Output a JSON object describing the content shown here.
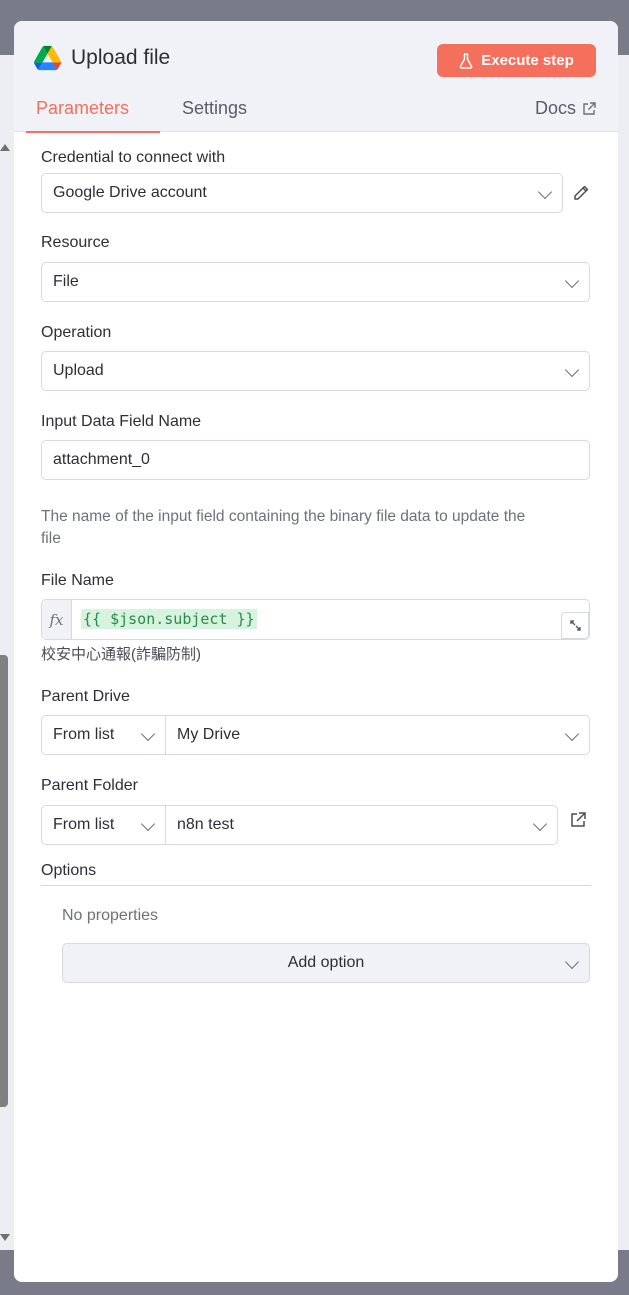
{
  "header": {
    "title": "Upload file",
    "execute_label": "Execute step",
    "tabs": [
      {
        "label": "Parameters",
        "active": true
      },
      {
        "label": "Settings",
        "active": false
      }
    ],
    "docs_label": "Docs"
  },
  "fields": {
    "credential": {
      "label": "Credential to connect with",
      "value": "Google Drive account"
    },
    "resource": {
      "label": "Resource",
      "value": "File"
    },
    "operation": {
      "label": "Operation",
      "value": "Upload"
    },
    "input_field": {
      "label": "Input Data Field Name",
      "value": "attachment_0",
      "hint_line1": "The name of the input field containing the binary file data to update the",
      "hint_line2": "file"
    },
    "file_name": {
      "label": "File Name",
      "fx": "fx",
      "expression": "{{ $json.subject }}",
      "preview": "校安中心通報(詐騙防制)"
    },
    "parent_drive": {
      "label": "Parent Drive",
      "mode": "From list",
      "value": "My Drive"
    },
    "parent_folder": {
      "label": "Parent Folder",
      "mode": "From list",
      "value": "n8n test"
    },
    "options": {
      "label": "Options",
      "empty_text": "No properties",
      "add_label": "Add option"
    }
  },
  "colors": {
    "accent": "#f56f5d",
    "header_bg": "#f0f2f7",
    "expression_text": "#2a8a4e",
    "expression_bg": "#d5f3dd"
  },
  "icons": [
    "google-drive-logo",
    "flask-icon",
    "external-link-icon",
    "pencil-icon",
    "expand-icon",
    "chevron-down-icon"
  ]
}
